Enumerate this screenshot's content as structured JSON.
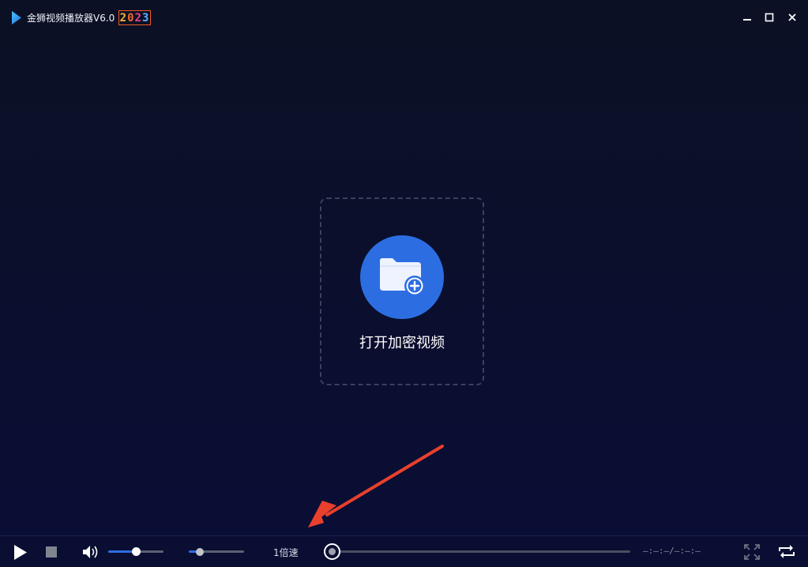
{
  "app": {
    "title": "金狮视频播放器V6.0",
    "year_badge": "2023",
    "colors": {
      "accent": "#2c6ee2",
      "background": "#0b0f2c",
      "badge_border": "#f05a28",
      "annotation": "#e8402c"
    }
  },
  "window_controls": {
    "minimize_icon": "minimize-icon",
    "maximize_icon": "maximize-icon",
    "close_icon": "close-icon"
  },
  "main": {
    "open_button_icon": "folder-plus-icon",
    "open_label": "打开加密视频"
  },
  "controls": {
    "play_icon": "play-icon",
    "stop_icon": "stop-icon",
    "volume_icon": "volume-icon",
    "volume_level": 0.5,
    "second_slider_level": 0.2,
    "speed_label": "1倍速",
    "progress_level": 0,
    "time_display": "—:—:—/—:—:—",
    "fullscreen_icon": "fullscreen-icon",
    "loop_icon": "loop-icon"
  }
}
